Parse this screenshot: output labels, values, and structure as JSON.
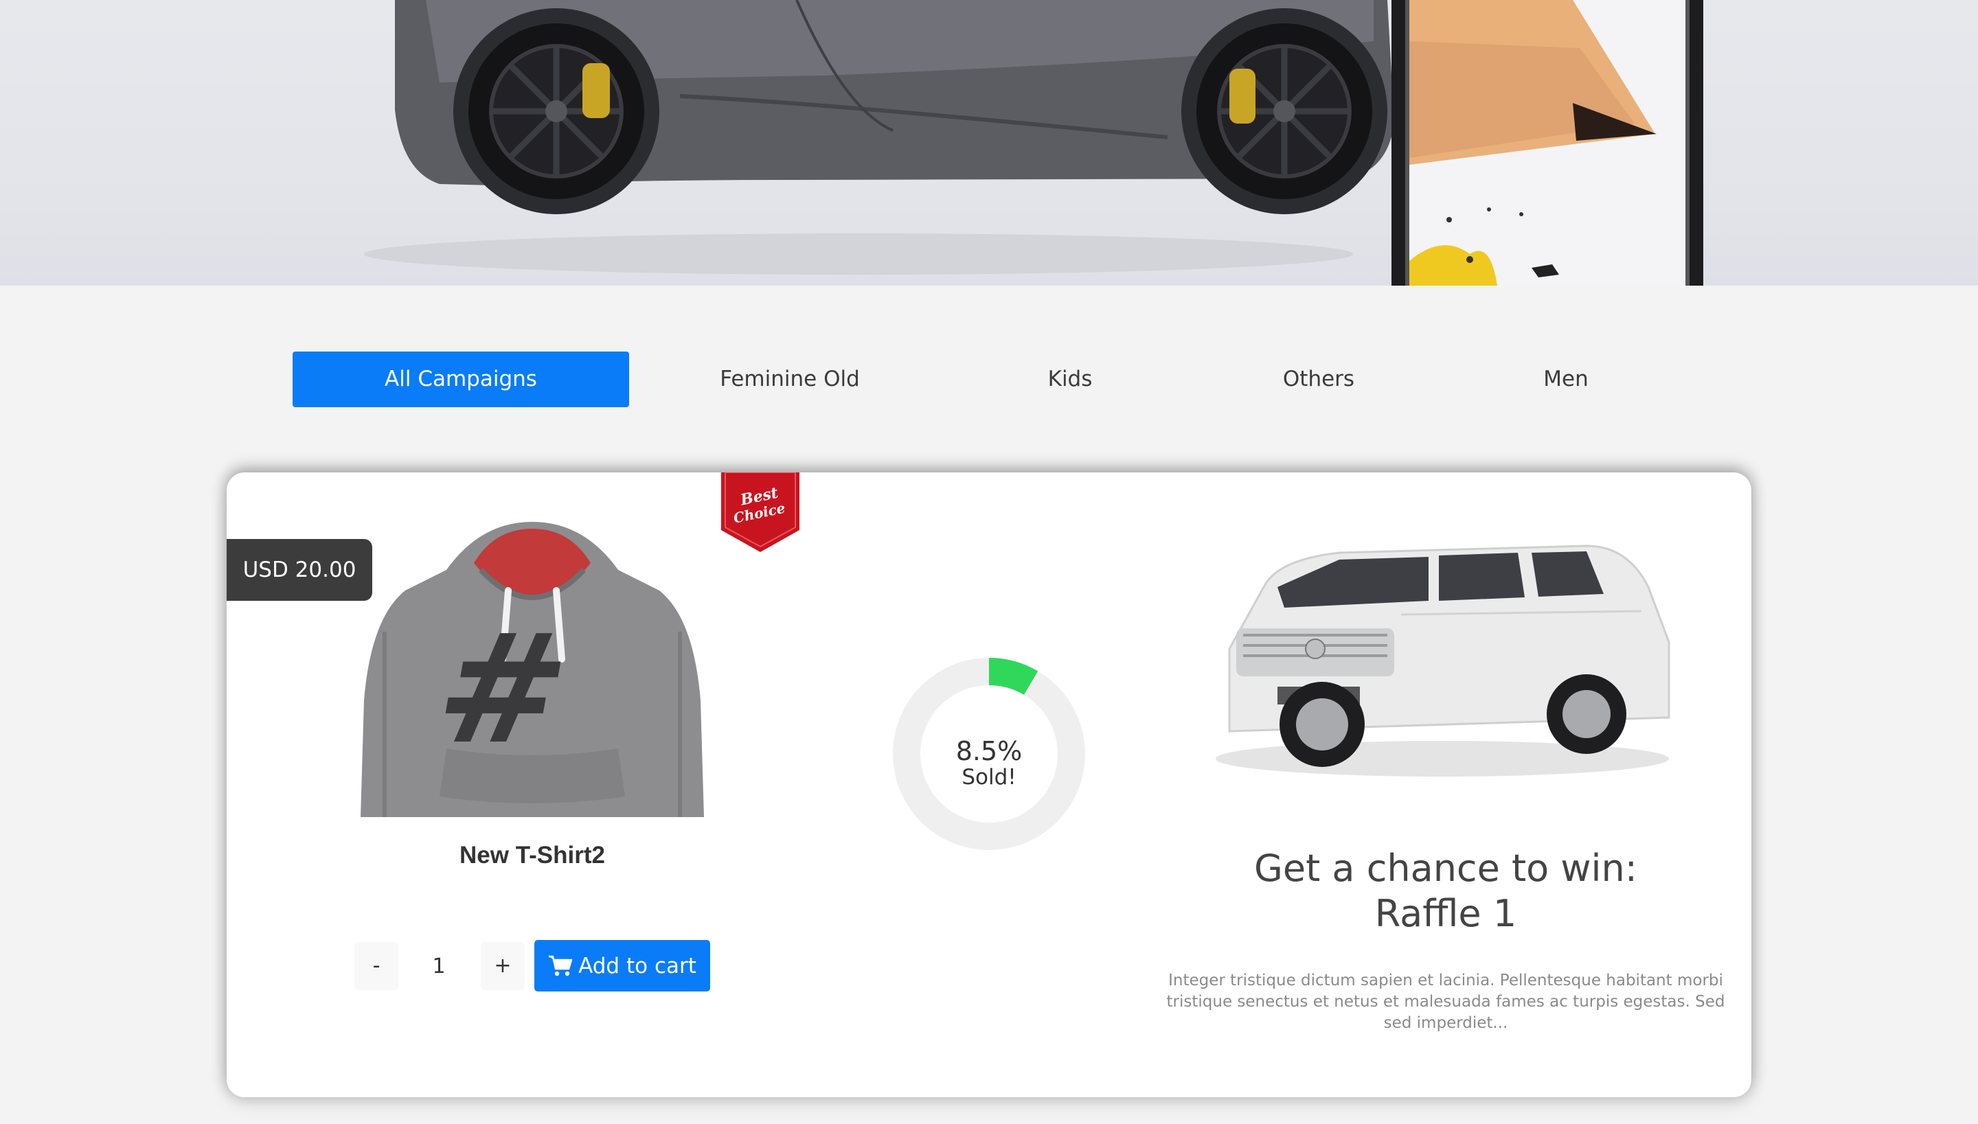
{
  "hero": {
    "car_icon": "sports-car",
    "phone_icon": "phone-with-pencil"
  },
  "tabs": [
    {
      "label": "All Campaigns",
      "active": true
    },
    {
      "label": "Feminine Old",
      "active": false
    },
    {
      "label": "Kids",
      "active": false
    },
    {
      "label": "Others",
      "active": false
    },
    {
      "label": "Men",
      "active": false
    }
  ],
  "campaign": {
    "price": "USD 20.00",
    "badge_icon": "best-choice-ribbon",
    "product": {
      "name": "New T-Shirt2",
      "image_icon": "hoodie-with-hash"
    },
    "quantity": {
      "minus_label": "-",
      "value": "1",
      "plus_label": "+"
    },
    "add_to_cart_label": "Add to cart",
    "sold": {
      "percent_label": "8.5%",
      "percent_value": 8.5,
      "label": "Sold!"
    },
    "raffle": {
      "title_line1": "Get a chance to win:",
      "title_line2": "Raffle 1",
      "description": "Integer tristique dictum sapien et lacinia. Pellentesque habitant morbi tristique senectus et netus et malesuada fames ac turpis egestas. Sed sed imperdiet...",
      "prize_icon": "white-suv"
    }
  },
  "colors": {
    "accent": "#0a7cf7",
    "progress": "#2fd85a",
    "price_tag": "#3c3c3c",
    "badge": "#c8141e"
  }
}
